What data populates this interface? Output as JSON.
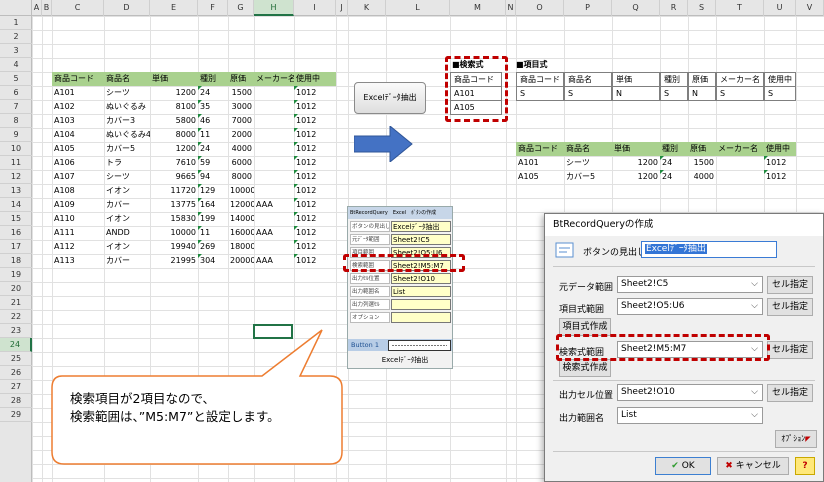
{
  "columns": [
    "A",
    "B",
    "C",
    "D",
    "E",
    "F",
    "G",
    "H",
    "I",
    "J",
    "K",
    "L",
    "M",
    "N",
    "O",
    "P",
    "Q",
    "R",
    "S",
    "T",
    "U",
    "V"
  ],
  "rows": [
    "1",
    "2",
    "3",
    "4",
    "5",
    "6",
    "7",
    "8",
    "9",
    "10",
    "11",
    "12",
    "13",
    "14",
    "15",
    "16",
    "17",
    "18",
    "19",
    "20",
    "21",
    "22",
    "23",
    "24",
    "25",
    "26",
    "27",
    "28",
    "29"
  ],
  "selected_col": "H",
  "selected_row": "24",
  "product_table": {
    "headers": [
      "商品コード",
      "商品名",
      "単価",
      "種別",
      "原価",
      "メーカー名",
      "使用中"
    ],
    "rows": [
      [
        "A101",
        "シーツ",
        "1200",
        "24",
        "1500",
        "",
        "1012"
      ],
      [
        "A102",
        "ぬいぐるみ",
        "8100",
        "35",
        "3000",
        "",
        "1012"
      ],
      [
        "A103",
        "カバー3",
        "5800",
        "46",
        "7000",
        "",
        "1012"
      ],
      [
        "A104",
        "ぬいぐるみ4",
        "8000",
        "11",
        "2000",
        "",
        "1012"
      ],
      [
        "A105",
        "カバー5",
        "1200",
        "24",
        "4000",
        "",
        "1012"
      ],
      [
        "A106",
        "トラ",
        "7610",
        "59",
        "6000",
        "",
        "1012"
      ],
      [
        "A107",
        "シーツ",
        "9665",
        "94",
        "8000",
        "",
        "1012"
      ],
      [
        "A108",
        "イオン",
        "11720",
        "129",
        "10000",
        "",
        "1012"
      ],
      [
        "A109",
        "カバー",
        "13775",
        "164",
        "12000",
        "AAA",
        "1012"
      ],
      [
        "A110",
        "イオン",
        "15830",
        "199",
        "14000",
        "",
        "1012"
      ],
      [
        "A111",
        "ANDD",
        "10000",
        "11",
        "16000",
        "AAA",
        "1012"
      ],
      [
        "A112",
        "イオン",
        "19940",
        "269",
        "18000",
        "",
        "1012"
      ],
      [
        "A113",
        "カバー",
        "21995",
        "304",
        "20000",
        "AAA",
        "1012"
      ]
    ]
  },
  "search_criteria": {
    "title": "■検索式",
    "header": "商品コード",
    "values": [
      "A101",
      "A105"
    ]
  },
  "item_formula": {
    "title": "■項目式",
    "headers": [
      "商品コード",
      "商品名",
      "単価",
      "種別",
      "原価",
      "メーカー名",
      "使用中"
    ],
    "values": [
      "S",
      "S",
      "N",
      "S",
      "N",
      "S",
      "S"
    ]
  },
  "result_table": {
    "headers": [
      "商品コード",
      "商品名",
      "単価",
      "種別",
      "原価",
      "メーカー名",
      "使用中"
    ],
    "rows": [
      [
        "A101",
        "シーツ",
        "1200",
        "24",
        "1500",
        "",
        "1012"
      ],
      [
        "A105",
        "カバー5",
        "1200",
        "24",
        "4000",
        "",
        "1012"
      ]
    ]
  },
  "excel_button_label": "Excelﾃﾞｰﾀ抽出",
  "mini_form": {
    "title": "BtRecordQuery　Excel　ﾎﾞﾀﾝの作成",
    "rows": [
      {
        "label": "ボタンの見出し",
        "value": "Excelﾃﾞｰﾀ抽出"
      },
      {
        "label": "元ﾃﾞｰﾀ範囲",
        "value": "Sheet2!C5"
      },
      {
        "label": "項目範囲",
        "value": "Sheet2!O5:U6"
      },
      {
        "label": "検索範囲",
        "value": "Sheet2!M5:M7"
      },
      {
        "label": "出力ｾﾙ位置",
        "value": "Sheet2!O10"
      },
      {
        "label": "出力範囲名",
        "value": "List"
      },
      {
        "label": "出力列選ｾﾙ",
        "value": ""
      },
      {
        "label": "オプション",
        "value": ""
      }
    ],
    "button_label": "Button 1",
    "bottom_label": "Excelﾃﾞｰﾀ抽出"
  },
  "callout": {
    "line1": "検索項目が2項目なので、",
    "line2": "検索範囲は、”M5:M7”と設定します。"
  },
  "dialog": {
    "title": "BtRecordQueryの作成",
    "caption_label": "ボタンの見出し",
    "caption_value": "Excelﾃﾞｰﾀ抽出",
    "source_label": "元データ範囲",
    "source_value": "Sheet2!C5",
    "item_label": "項目式範囲",
    "item_value": "Sheet2!O5:U6",
    "item_create": "項目式作成",
    "search_label": "検索式範囲",
    "search_value": "Sheet2!M5:M7",
    "search_create": "検索式作成",
    "output_label": "出力セル位置",
    "output_value": "Sheet2!O10",
    "range_label": "出力範囲名",
    "range_value": "List",
    "cell_btn": "セル指定",
    "option_btn": "ｵﾌﾟｼｮﾝ",
    "ok": "OK",
    "cancel": "キャンセル",
    "help": "?"
  },
  "colors": {
    "header_green": "#a9d18e",
    "dash_red": "#c00000",
    "arrow_blue": "#4472c4",
    "callout_orange": "#ed7d31"
  }
}
